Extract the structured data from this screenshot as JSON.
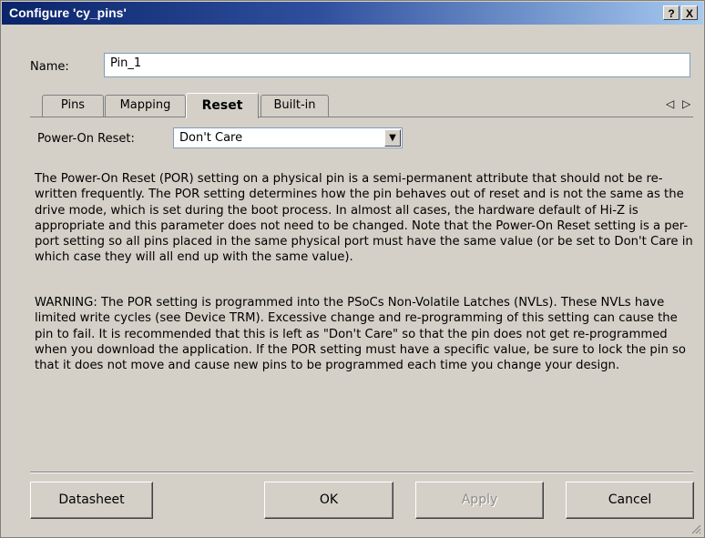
{
  "window": {
    "title": "Configure 'cy_pins'",
    "help_glyph": "?",
    "close_glyph": "X"
  },
  "name": {
    "label": "Name:",
    "value": "Pin_1"
  },
  "tabs": [
    {
      "label": "Pins",
      "active": false
    },
    {
      "label": "Mapping",
      "active": false
    },
    {
      "label": "Reset",
      "active": true
    },
    {
      "label": "Built-in",
      "active": false
    }
  ],
  "tab_scroll": {
    "left": "◁",
    "right": "▷"
  },
  "power_on_reset": {
    "label": "Power-On Reset:",
    "value": "Don't Care"
  },
  "description": "The Power-On Reset (POR) setting on a physical pin is a semi-permanent attribute that should not be re-written frequently. The POR setting determines how the pin behaves out of reset and is not the same as the drive mode, which is set during the boot process. In almost all cases, the hardware default of Hi-Z is appropriate and this parameter does not need to be changed. Note that the Power-On Reset setting is a per-port setting so all pins placed in the same physical port must have the same value (or be set to Don't Care in which case they will all end up with the same value).",
  "warning": "WARNING: The POR setting is programmed into the PSoCs Non-Volatile Latches (NVLs). These NVLs have limited write cycles (see Device TRM). Excessive change and re-programming of this setting can cause the pin to fail. It is recommended that this is left as \"Don't Care\" so that the pin does not get re-programmed when you download the application. If the POR setting must have a specific value, be sure to lock the pin so that it does not move and cause new pins to be programmed each time you change your design.",
  "buttons": {
    "datasheet": "Datasheet",
    "ok": "OK",
    "apply": "Apply",
    "cancel": "Cancel"
  }
}
